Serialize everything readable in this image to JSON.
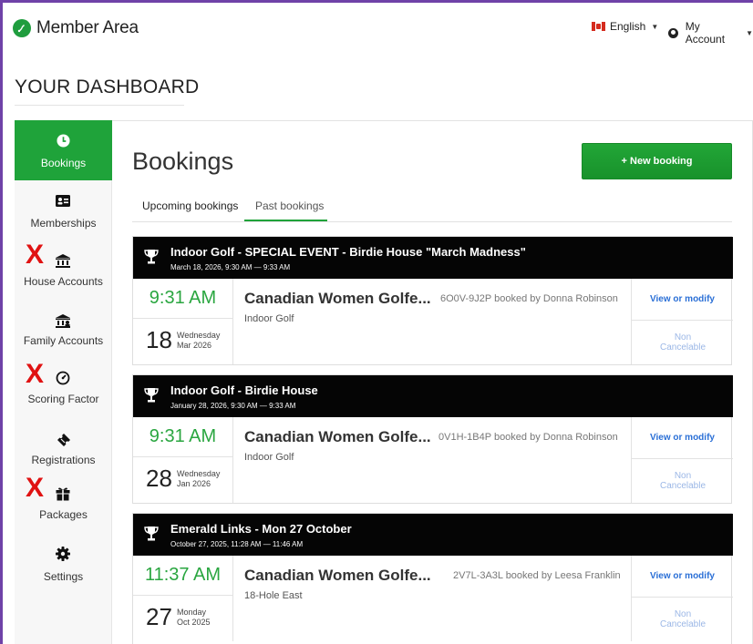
{
  "header": {
    "brand": "Member Area",
    "language": "English",
    "account": "My Account"
  },
  "dashboard_title": "YOUR DASHBOARD",
  "sidebar": {
    "items": [
      {
        "label": "Bookings",
        "icon": "clock-icon",
        "active": true
      },
      {
        "label": "Memberships",
        "icon": "id-card-icon",
        "active": false
      },
      {
        "label": "House Accounts",
        "icon": "bank-icon",
        "active": false,
        "crossed": true
      },
      {
        "label": "Family Accounts",
        "icon": "family-bank-icon",
        "active": false
      },
      {
        "label": "Scoring Factor",
        "icon": "gauge-icon",
        "active": false,
        "crossed": true
      },
      {
        "label": "Registrations",
        "icon": "ticket-icon",
        "active": false
      },
      {
        "label": "Packages",
        "icon": "gift-icon",
        "active": false,
        "crossed": true
      },
      {
        "label": "Settings",
        "icon": "gear-icon",
        "active": false
      }
    ],
    "cross_mark": "X"
  },
  "main": {
    "title": "Bookings",
    "new_booking": "+ New booking",
    "tabs": [
      {
        "label": "Upcoming bookings",
        "active": false
      },
      {
        "label": "Past bookings",
        "active": true
      }
    ]
  },
  "bookings": [
    {
      "title": "Indoor Golf - SPECIAL EVENT - Birdie House \"March Madness\"",
      "subtitle": "March 18, 2026, 9:30 AM — 9:33 AM",
      "time": "9:31 AM",
      "day": "18",
      "weekday": "Wednesday",
      "month": "Mar 2026",
      "name": "Canadian Women Golfe...",
      "code": "6O0V-9J2P booked by Donna Robinson",
      "category": "Indoor Golf",
      "action": "View or modify",
      "status": "Non Cancelable"
    },
    {
      "title": "Indoor Golf - Birdie House",
      "subtitle": "January 28, 2026, 9:30 AM — 9:33 AM",
      "time": "9:31 AM",
      "day": "28",
      "weekday": "Wednesday",
      "month": "Jan 2026",
      "name": "Canadian Women Golfe...",
      "code": "0V1H-1B4P booked by Donna Robinson",
      "category": "Indoor Golf",
      "action": "View or modify",
      "status": "Non Cancelable"
    },
    {
      "title": "Emerald Links - Mon 27 October",
      "subtitle": "October 27, 2025, 11:28 AM — 11:46 AM",
      "time": "11:37 AM",
      "day": "27",
      "weekday": "Monday",
      "month": "Oct 2025",
      "name": "Canadian Women Golfe...",
      "code": "2V7L-3A3L booked by Leesa Franklin",
      "category": "18-Hole East",
      "action": "View or modify",
      "status": "Non Cancelable"
    }
  ],
  "colors": {
    "accent": "#1fa33a",
    "link": "#2a6fd6",
    "header_bg": "#050505",
    "cross": "#e01212",
    "frame": "#6f42a8"
  }
}
